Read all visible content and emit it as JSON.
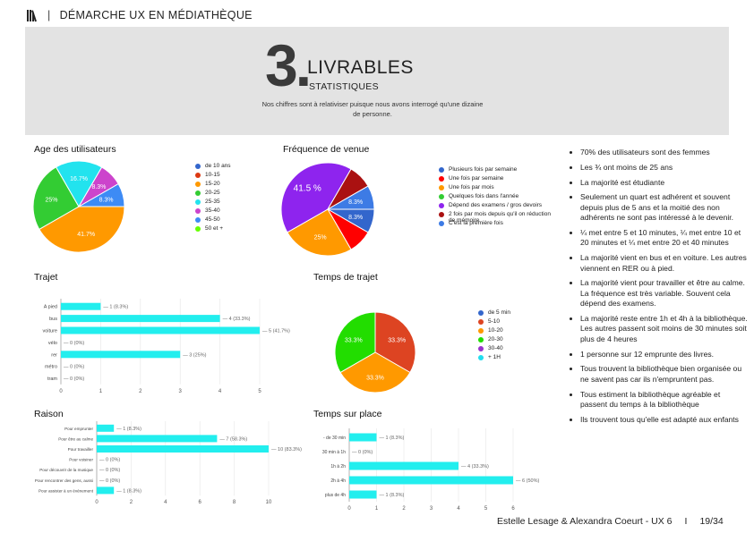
{
  "header": {
    "title": "DÉMARCHE UX EN MÉDIATHÈQUE"
  },
  "banner": {
    "number": "3.",
    "title": "LIVRABLES",
    "subtitle": "STATISTIQUES",
    "note": "Nos chiffres sont à relativiser puisque nous avons interrogé qu'une dizaine de personne."
  },
  "colors": {
    "banner_bg": "#e3e3e3"
  },
  "chart_data": [
    {
      "id": "age",
      "type": "pie",
      "title": "Age des utilisateurs",
      "slices": [
        {
          "label": "de 10 ans",
          "value": 0,
          "color": "#3366cc"
        },
        {
          "label": "10-15",
          "value": 0,
          "color": "#dc3912"
        },
        {
          "label": "15-20",
          "value": 41.7,
          "color": "#ff9900",
          "data_label": "41.7%"
        },
        {
          "label": "20-25",
          "value": 25,
          "color": "#33cc33",
          "data_label": "25%"
        },
        {
          "label": "25-35",
          "value": 16.7,
          "color": "#22e3ee",
          "data_label": "16.7%"
        },
        {
          "label": "35-40",
          "value": 8.3,
          "color": "#cc44cc",
          "data_label": "8.3%"
        },
        {
          "label": "45-50",
          "value": 8.3,
          "color": "#3d8bf5",
          "data_label": "8.3%"
        },
        {
          "label": "50 et +",
          "value": 0,
          "color": "#66ff00"
        }
      ]
    },
    {
      "id": "freq",
      "type": "pie",
      "title": "Fréquence de venue",
      "slices": [
        {
          "label": "Plusieurs fois par semaine",
          "value": 8.3,
          "color": "#3366cc",
          "data_label": "8.3%"
        },
        {
          "label": "Une fois par semaine",
          "value": 8.3,
          "color": "#ff0000",
          "data_label": ""
        },
        {
          "label": "Une fois par mois",
          "value": 25,
          "color": "#ff9900",
          "data_label": "25%"
        },
        {
          "label": "Quelques fois dans l'année",
          "value": 0,
          "color": "#33cc33"
        },
        {
          "label": "Dépend des examens / gros devoirs",
          "value": 41.5,
          "color": "#8e24ee",
          "data_label": "41.5 %"
        },
        {
          "label": "2 fois par mois depuis qu'il on réduction de mémoire",
          "value": 8.3,
          "color": "#aa1111",
          "data_label": ""
        },
        {
          "label": "C'est la première fois",
          "value": 8.3,
          "color": "#3d7be5",
          "data_label": "8.3%"
        }
      ]
    },
    {
      "id": "trajet",
      "type": "bar",
      "orientation": "horizontal",
      "title": "Trajet",
      "categories": [
        "A pied",
        "bus",
        "voiture",
        "vélo",
        "rer",
        "métro",
        "tram"
      ],
      "values": [
        1,
        4,
        5,
        0,
        3,
        0,
        0
      ],
      "data_labels": [
        "1 (8.3%)",
        "4 (33.3%)",
        "5 (41.7%)",
        "0 (0%)",
        "3 (25%)",
        "0 (0%)",
        "0 (0%)"
      ],
      "xticks": [
        "0",
        "1",
        "2",
        "3",
        "4",
        "5"
      ],
      "xlim": [
        0,
        5
      ],
      "color": "#22eeee"
    },
    {
      "id": "temps",
      "type": "pie",
      "title": "Temps de trajet",
      "slices": [
        {
          "label": "de 5 min",
          "value": 0,
          "color": "#3366cc"
        },
        {
          "label": "5-10",
          "value": 33.3,
          "color": "#dd4422",
          "data_label": "33.3%"
        },
        {
          "label": "10-20",
          "value": 33.3,
          "color": "#ff9900",
          "data_label": "33.3%"
        },
        {
          "label": "20-30",
          "value": 33.3,
          "color": "#22dd00",
          "data_label": "33.3%"
        },
        {
          "label": "30-40",
          "value": 0,
          "color": "#9933cc"
        },
        {
          "label": "+ 1H",
          "value": 0,
          "color": "#22ddee"
        }
      ]
    },
    {
      "id": "raison",
      "type": "bar",
      "orientation": "horizontal",
      "title": "Raison",
      "categories": [
        "Pour emprunter",
        "Pour être au calme",
        "Pour travailler",
        "Pour voisiner",
        "Pour découvrir de la musique",
        "Pour rencontrer des gens, aussi",
        "Pour assister à un événement"
      ],
      "values": [
        1,
        7,
        10,
        0,
        0,
        0,
        1
      ],
      "data_labels": [
        "1 (8.3%)",
        "7 (58.3%)",
        "10 (83.3%)",
        "0 (0%)",
        "0 (0%)",
        "0 (0%)",
        "1 (8.3%)"
      ],
      "xticks": [
        "0",
        "2",
        "4",
        "6",
        "8",
        "10"
      ],
      "xlim": [
        0,
        10
      ],
      "color": "#22eeee"
    },
    {
      "id": "surplace",
      "type": "bar",
      "orientation": "horizontal",
      "title": "Temps sur place",
      "categories": [
        "- de 30 min",
        "30 min à 1h",
        "1h à 2h",
        "2h à 4h",
        "plus de 4h"
      ],
      "values": [
        1,
        0,
        4,
        6,
        1
      ],
      "data_labels": [
        "1 (8.3%)",
        "0 (0%)",
        "4 (33.3%)",
        "6 (50%)",
        "1 (8.3%)"
      ],
      "xticks": [
        "0",
        "1",
        "2",
        "3",
        "4",
        "5",
        "6"
      ],
      "xlim": [
        0,
        6
      ],
      "color": "#22eeee"
    }
  ],
  "bullets": [
    "70% des utilisateurs sont des femmes",
    "Les ¾ ont moins de 25 ans",
    "La majorité est étudiante",
    "Seulement un quart est adhérent et souvent depuis plus de 5 ans et la moitié des non adhérents ne sont pas intéressé à le devenir.",
    "¼ met entre 5 et 10 minutes, ¼ met entre 10 et 20 minutes et ¼ met entre 20 et 40 minutes",
    "La majorité vient en bus et en voiture. Les autres viennent en RER ou à pied.",
    "La majorité vient pour travailler et être au calme. La fréquence est très variable. Souvent cela dépend des examens.",
    "La majorité reste entre 1h et 4h à la bibliothèque. Les autres passent soit moins de 30 minutes soit plus de 4 heures",
    "1 personne sur 12 emprunte des livres.",
    "Tous trouvent la bibliothèque bien organisée ou ne savent pas car ils n'empruntent pas.",
    "Tous estiment la bibliothèque agréable et passent du temps à la bibliothèque",
    "Ils trouvent tous qu'elle est adapté aux enfants"
  ],
  "footer": {
    "authors": "Estelle Lesage & Alexandra Coeurt - UX 6",
    "separator": "I",
    "page": "19/34"
  }
}
